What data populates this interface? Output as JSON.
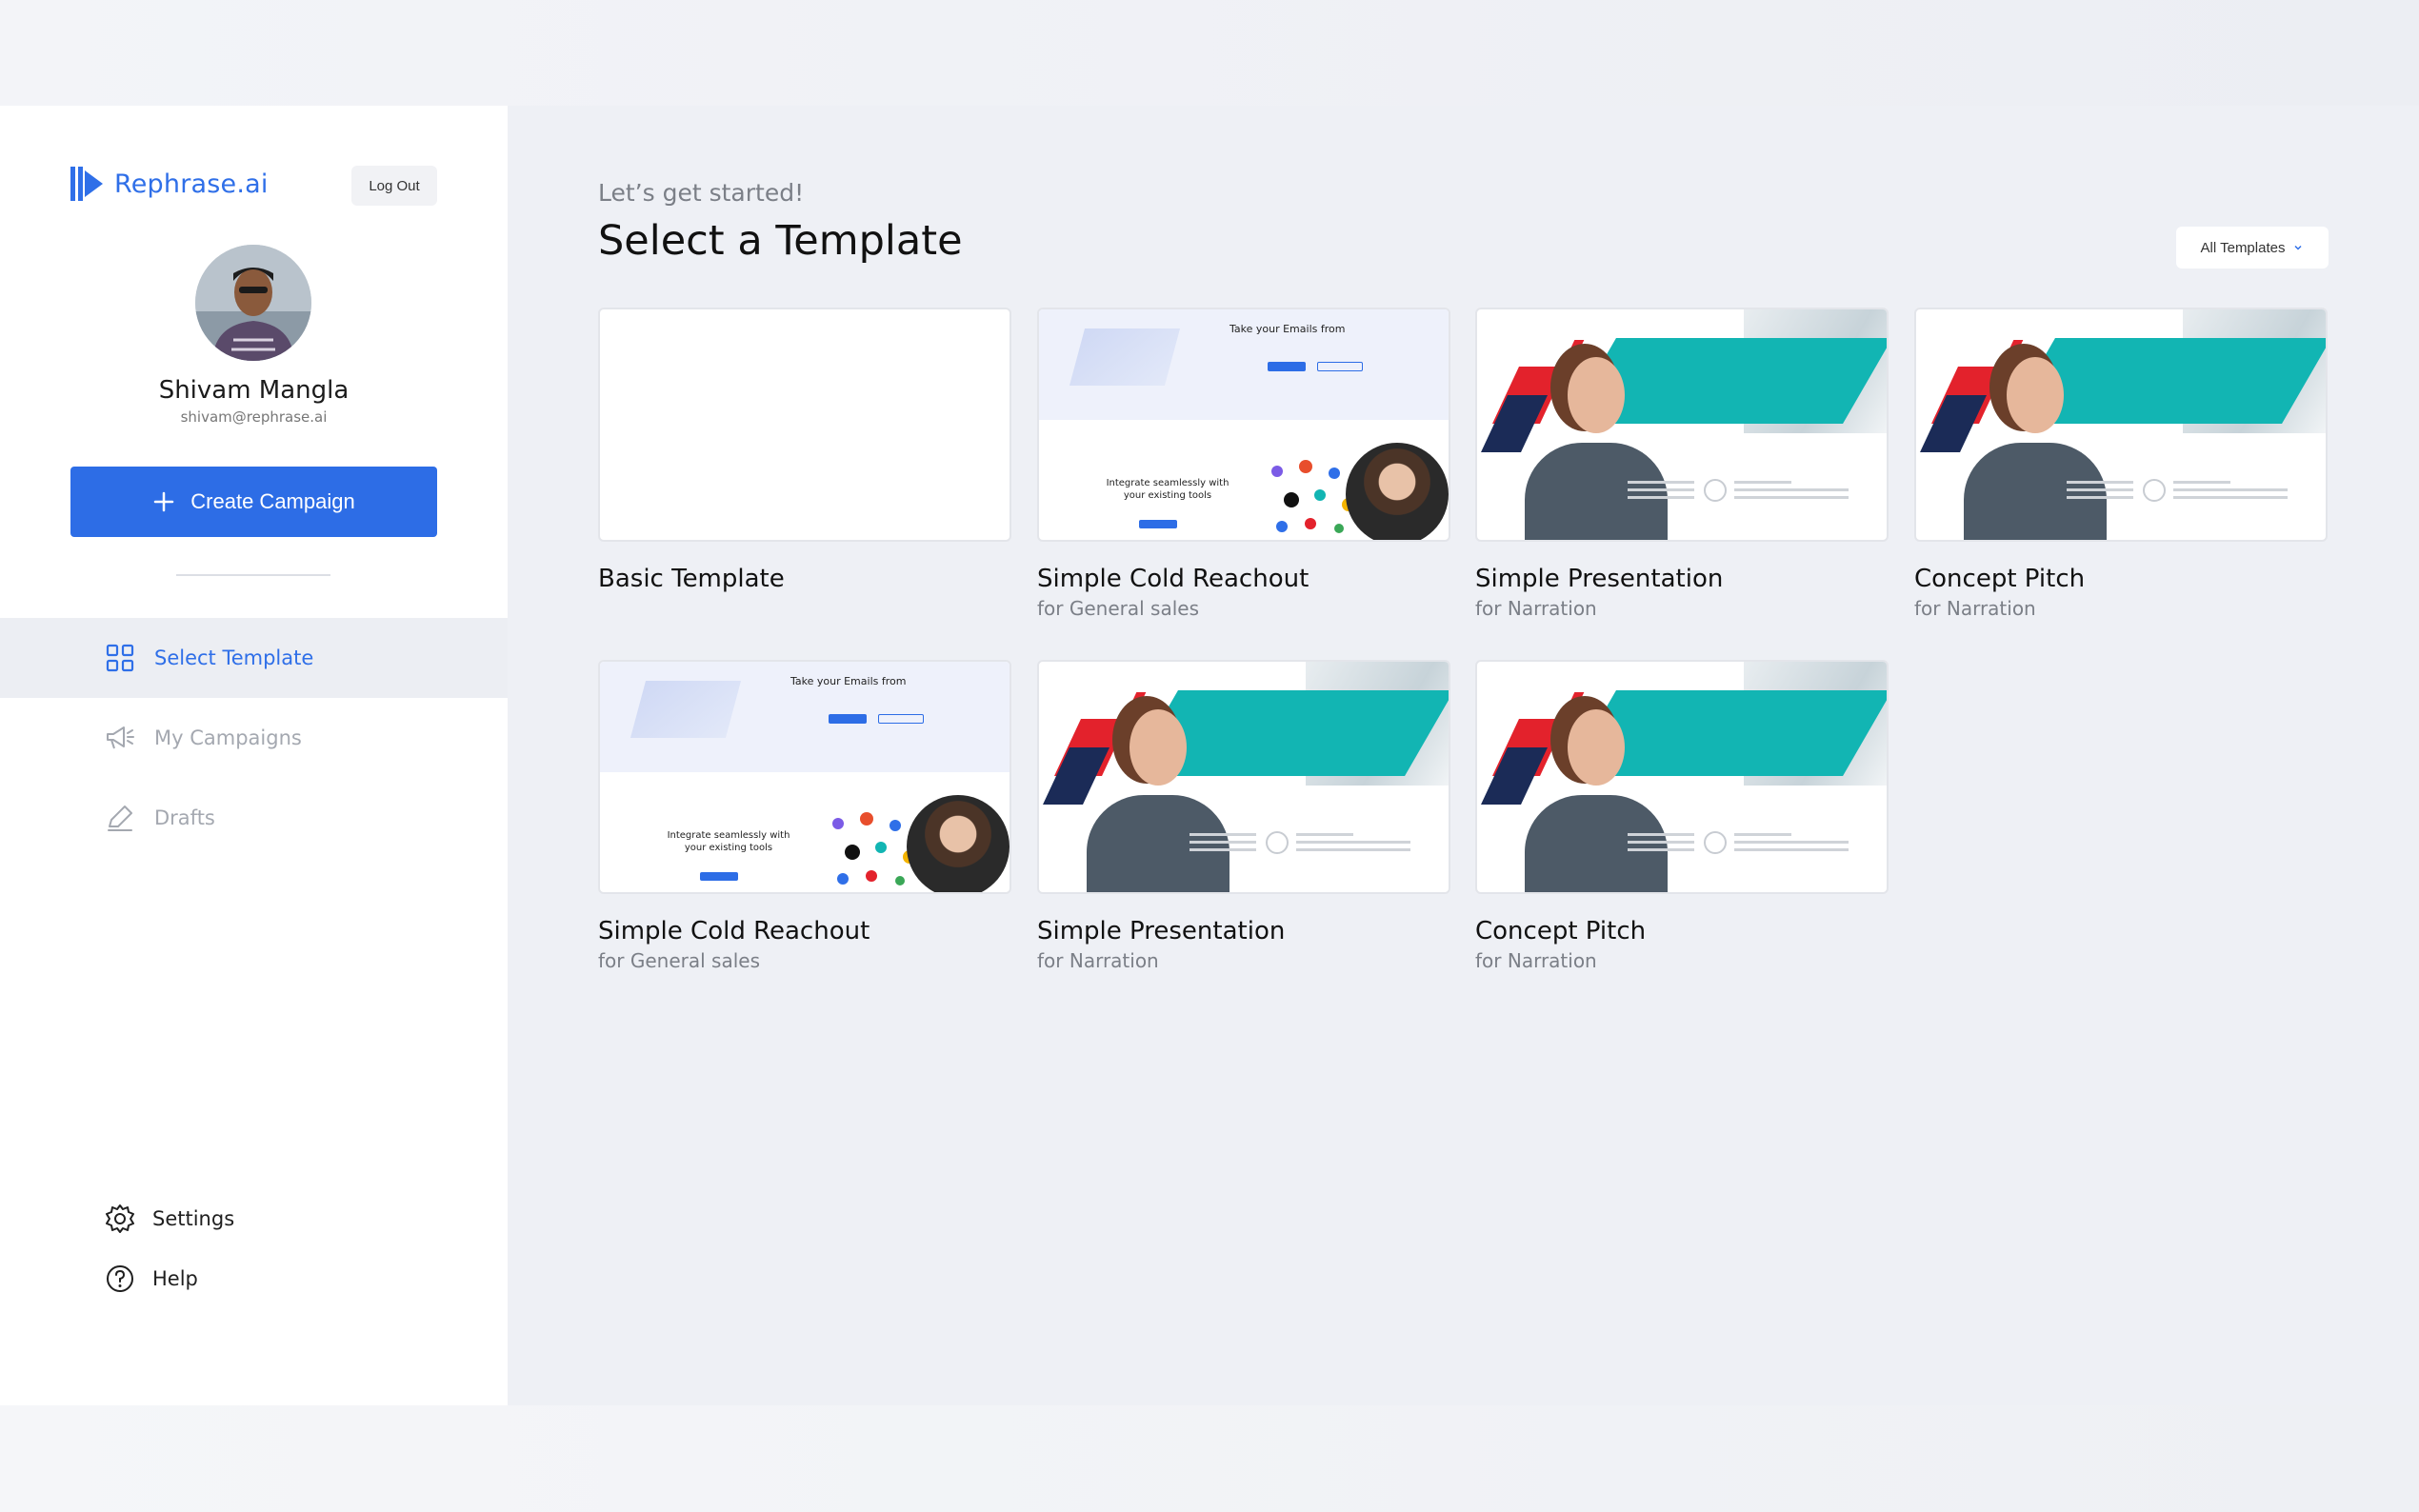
{
  "app": {
    "brand": "Rephrase.ai",
    "logout_label": "Log Out"
  },
  "user": {
    "name": "Shivam Mangla",
    "email": "shivam@rephrase.ai"
  },
  "create_button_label": "Create Campaign",
  "nav": [
    {
      "label": "Select Template",
      "icon": "grid-icon",
      "active": true
    },
    {
      "label": "My Campaigns",
      "icon": "megaphone-icon",
      "active": false
    },
    {
      "label": "Drafts",
      "icon": "pencil-icon",
      "active": false
    }
  ],
  "bottom_nav": [
    {
      "label": "Settings",
      "icon": "gear-icon"
    },
    {
      "label": "Help",
      "icon": "help-icon"
    }
  ],
  "main": {
    "intro": "Let’s get started!",
    "title": "Select a Template",
    "filter_label": "All Templates"
  },
  "thumb_text": {
    "cr_heading": "Take your Emails from",
    "cr_integrate": "Integrate seamlessly with your existing tools"
  },
  "templates": [
    {
      "title": "Basic Template",
      "subtitle": "",
      "kind": "blank"
    },
    {
      "title": "Simple Cold Reachout",
      "subtitle": "for General sales",
      "kind": "cold"
    },
    {
      "title": "Simple Presentation",
      "subtitle": "for Narration",
      "kind": "presentation"
    },
    {
      "title": "Concept Pitch",
      "subtitle": "for Narration",
      "kind": "presentation"
    },
    {
      "title": "Simple Cold Reachout",
      "subtitle": "for General sales",
      "kind": "cold"
    },
    {
      "title": "Simple Presentation",
      "subtitle": "for Narration",
      "kind": "presentation"
    },
    {
      "title": "Concept Pitch",
      "subtitle": "for Narration",
      "kind": "presentation"
    }
  ],
  "colors": {
    "accent": "#2d6de6",
    "teal": "#12b5b3",
    "red": "#e3222c",
    "navy": "#1b2b57"
  }
}
